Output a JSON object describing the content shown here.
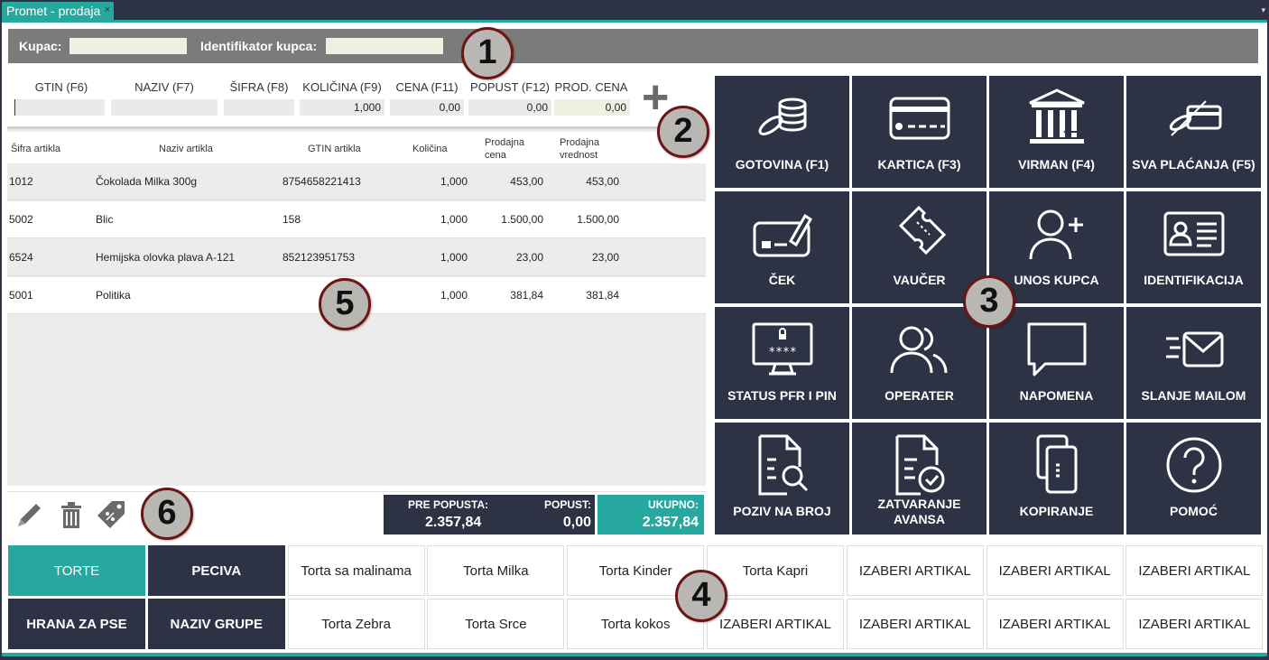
{
  "tab": {
    "title": "Promet - prodaja",
    "close": "×",
    "menu": "▾"
  },
  "customer": {
    "kupac_label": "Kupac:",
    "kupac_value": "",
    "id_label": "Identifikator kupca:",
    "id_value": ""
  },
  "entry": {
    "headers": [
      "GTIN (F6)",
      "NAZIV (F7)",
      "ŠIFRA (F8)",
      "KOLIČINA (F9)",
      "CENA (F11)",
      "POPUST (F12)",
      "PROD. CENA"
    ],
    "values": [
      "",
      "",
      "",
      "1,000",
      "0,00",
      "0,00",
      "0,00"
    ],
    "add_symbol": "+"
  },
  "grid": {
    "columns": [
      "Šifra artikla",
      "Naziv artikla",
      "GTIN artikla",
      "Količina",
      "Prodajna cena",
      "Prodajna vrednost"
    ],
    "rows": [
      {
        "sifra": "1012",
        "naziv": "Čokolada Milka 300g",
        "gtin": "8754658221413",
        "kolicina": "1,000",
        "cena": "453,00",
        "vrednost": "453,00"
      },
      {
        "sifra": "5002",
        "naziv": "Blic",
        "gtin": "158",
        "kolicina": "1,000",
        "cena": "1.500,00",
        "vrednost": "1.500,00"
      },
      {
        "sifra": "6524",
        "naziv": "Hemijska olovka plava A-121",
        "gtin": "852123951753",
        "kolicina": "1,000",
        "cena": "23,00",
        "vrednost": "23,00"
      },
      {
        "sifra": "5001",
        "naziv": "Politika",
        "gtin": "",
        "kolicina": "1,000",
        "cena": "381,84",
        "vrednost": "381,84"
      }
    ]
  },
  "totals": {
    "pre_label": "PRE POPUSTA:",
    "pre_value": "2.357,84",
    "popust_label": "POPUST:",
    "popust_value": "0,00",
    "ukupno_label": "UKUPNO:",
    "ukupno_value": "2.357,84"
  },
  "payments": [
    {
      "label": "GOTOVINA (F1)",
      "icon": "coins-icon"
    },
    {
      "label": "KARTICA (F3)",
      "icon": "credit-card-icon"
    },
    {
      "label": "VIRMAN (F4)",
      "icon": "bank-icon"
    },
    {
      "label": "SVA PLAĆANJA (F5)",
      "icon": "all-payments-icon"
    },
    {
      "label": "ČEK",
      "icon": "cheque-icon"
    },
    {
      "label": "VAUČER",
      "icon": "ticket-icon"
    },
    {
      "label": "UNOS KUPCA",
      "icon": "add-user-icon"
    },
    {
      "label": "IDENTIFIKACIJA",
      "icon": "id-card-icon"
    },
    {
      "label": "STATUS PFR I PIN",
      "icon": "monitor-lock-icon"
    },
    {
      "label": "OPERATER",
      "icon": "users-icon"
    },
    {
      "label": "NAPOMENA",
      "icon": "speech-bubble-icon"
    },
    {
      "label": "SLANJE MAILOM",
      "icon": "mail-icon"
    },
    {
      "label": "POZIV NA BROJ",
      "icon": "document-search-icon"
    },
    {
      "label": "ZATVARANJE AVANSA",
      "icon": "document-check-icon"
    },
    {
      "label": "KOPIRANJE",
      "icon": "copy-icon"
    },
    {
      "label": "POMOĆ",
      "icon": "help-icon"
    }
  ],
  "categories": {
    "row1": [
      "TORTE",
      "PECIVA",
      "Torta sa malinama",
      "Torta Milka",
      "Torta Kinder",
      "Torta Kapri",
      "IZABERI ARTIKAL",
      "IZABERI ARTIKAL",
      "IZABERI ARTIKAL"
    ],
    "row2": [
      "HRANA ZA PSE",
      "NAZIV GRUPE",
      "Torta Zebra",
      "Torta Srce",
      "Torta kokos",
      "IZABERI ARTIKAL",
      "IZABERI ARTIKAL",
      "IZABERI ARTIKAL",
      "IZABERI ARTIKAL"
    ]
  },
  "badges": [
    "1",
    "2",
    "3",
    "4",
    "5",
    "6"
  ],
  "colors": {
    "teal": "#26a8a0",
    "dark": "#2d3344",
    "badge_border": "#6d1414"
  }
}
